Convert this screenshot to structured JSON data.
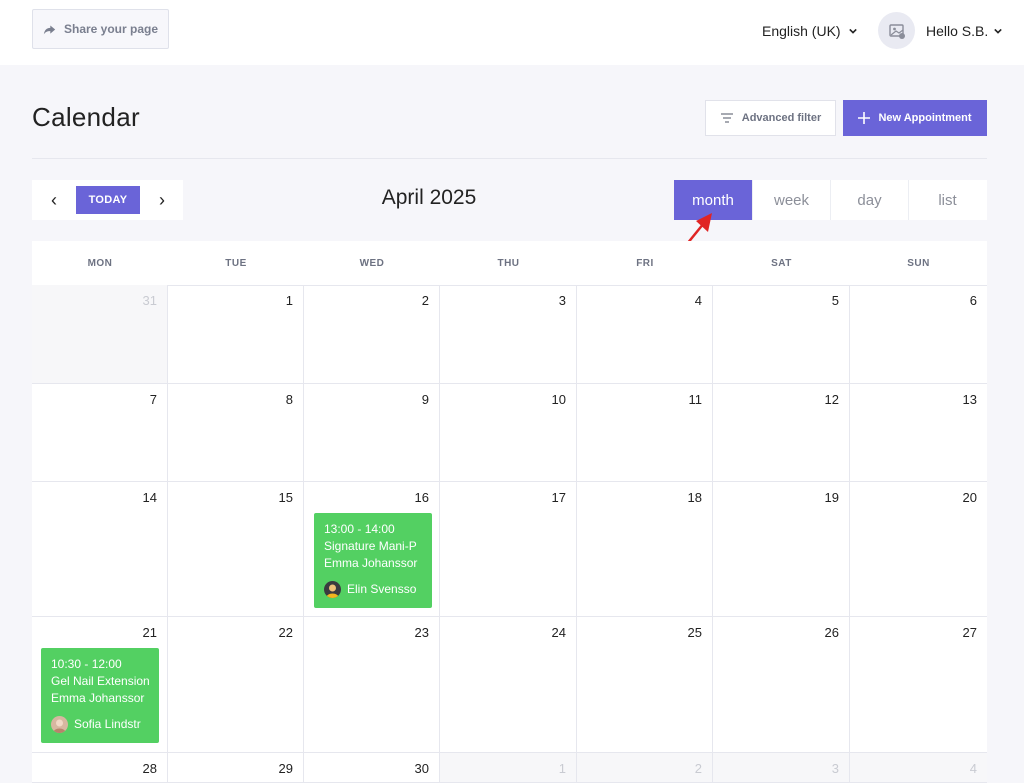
{
  "topbar": {
    "share_label": "Share your page",
    "language": "English (UK)",
    "user_greeting": "Hello S.B."
  },
  "header": {
    "title": "Calendar",
    "advanced_filter_label": "Advanced filter",
    "new_appointment_label": "New Appointment"
  },
  "nav": {
    "prev": "‹",
    "today": "TODAY",
    "next": "›",
    "month_title": "April 2025"
  },
  "views": {
    "month": "month",
    "week": "week",
    "day": "day",
    "list": "list",
    "active": "month"
  },
  "calendar": {
    "weekdays": [
      "MON",
      "TUE",
      "WED",
      "THU",
      "FRI",
      "SAT",
      "SUN"
    ],
    "weeks": [
      [
        "31",
        "1",
        "2",
        "3",
        "4",
        "5",
        "6"
      ],
      [
        "7",
        "8",
        "9",
        "10",
        "11",
        "12",
        "13"
      ],
      [
        "14",
        "15",
        "16",
        "17",
        "18",
        "19",
        "20"
      ],
      [
        "21",
        "22",
        "23",
        "24",
        "25",
        "26",
        "27"
      ],
      [
        "28",
        "29",
        "30",
        "1",
        "2",
        "3",
        "4"
      ]
    ],
    "events": [
      {
        "time": "13:00 - 14:00",
        "service": "Signature Mani-P",
        "client": "Emma Johanssor",
        "staff": "Elin Svensso"
      },
      {
        "time": "10:30 - 12:00",
        "service": "Gel Nail Extension",
        "client": "Emma Johanssor",
        "staff": "Sofia Lindstr"
      }
    ]
  },
  "colors": {
    "accent": "#6a64d8",
    "event": "#53d062",
    "annotation": "#e02424"
  }
}
